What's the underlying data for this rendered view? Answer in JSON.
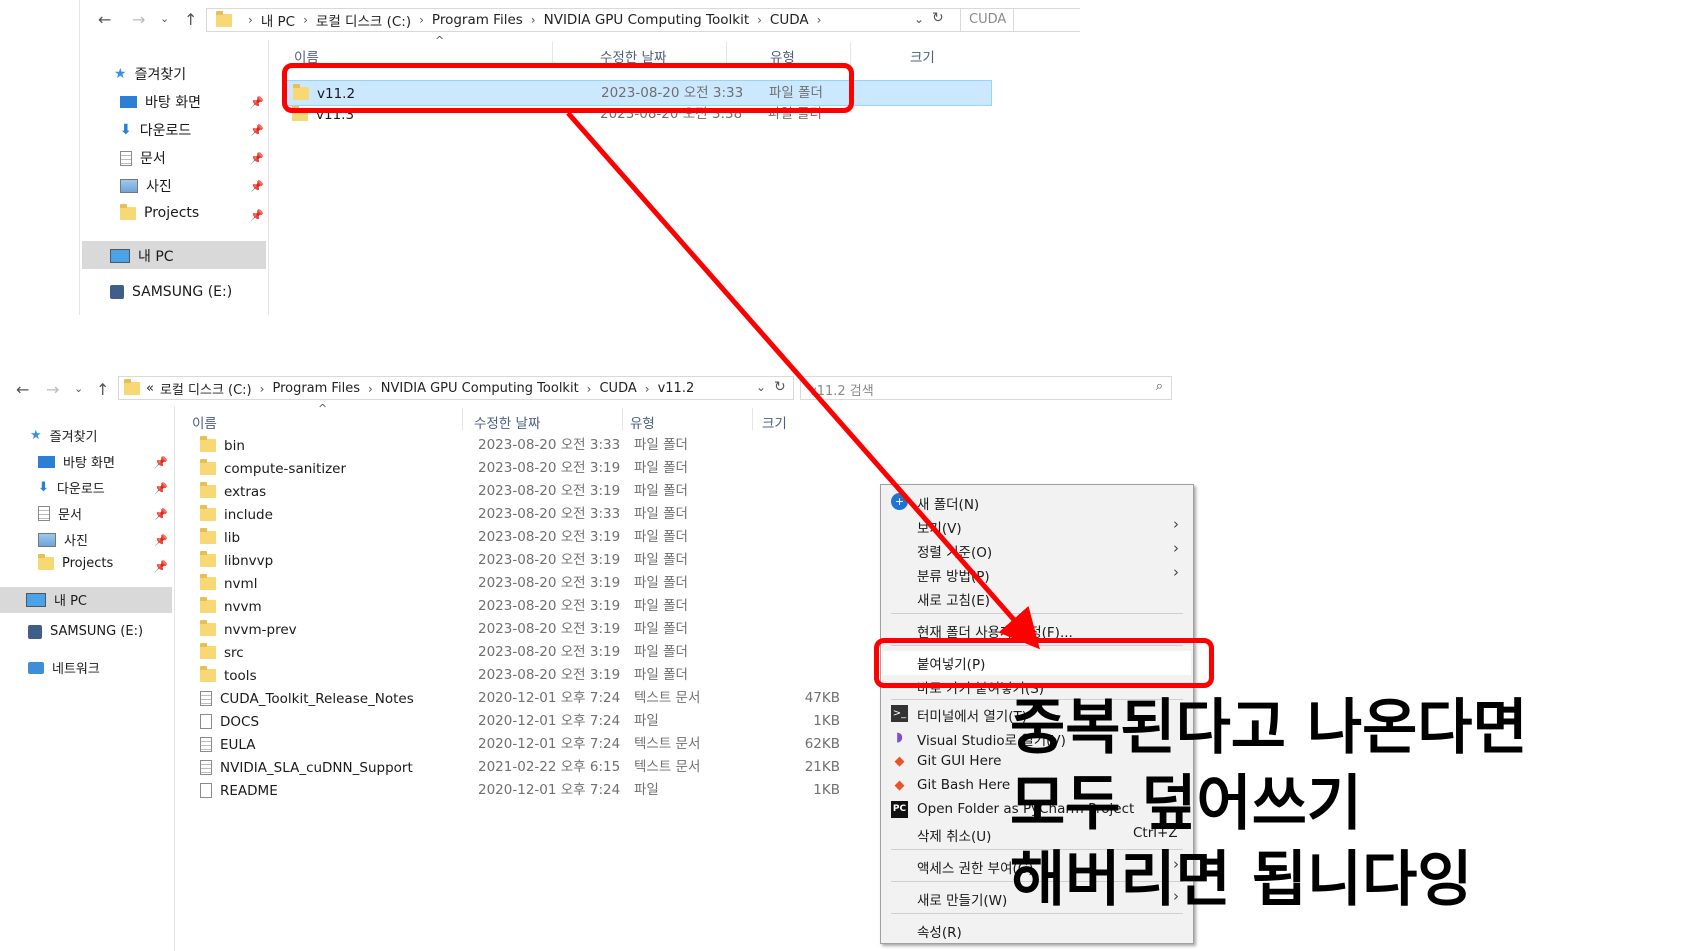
{
  "top_window": {
    "breadcrumb": [
      "내 PC",
      "로컬 디스크 (C:)",
      "Program Files",
      "NVIDIA GPU Computing Toolkit",
      "CUDA"
    ],
    "search_text": "CUDA",
    "columns": [
      "이름",
      "수정한 날짜",
      "유형",
      "크기"
    ],
    "sidebar": {
      "quick_access": "즐겨찾기",
      "items": [
        "바탕 화면",
        "다운로드",
        "문서",
        "사진",
        "Projects"
      ],
      "this_pc": "내 PC",
      "drive": "SAMSUNG (E:)"
    },
    "rows": [
      {
        "name": "v11.2",
        "date": "2023-08-20 오전 3:33",
        "type": "파일 폴더"
      },
      {
        "name": "v11.3",
        "date": "2023-08-20 오전 3:38",
        "type": "파일 폴더"
      }
    ]
  },
  "bottom_window": {
    "breadcrumb_prefix": "«",
    "breadcrumb": [
      "로컬 디스크 (C:)",
      "Program Files",
      "NVIDIA GPU Computing Toolkit",
      "CUDA",
      "v11.2"
    ],
    "search_placeholder": "v11.2 검색",
    "columns": [
      "이름",
      "수정한 날짜",
      "유형",
      "크기"
    ],
    "sidebar": {
      "quick_access": "즐겨찾기",
      "items": [
        "바탕 화면",
        "다운로드",
        "문서",
        "사진",
        "Projects"
      ],
      "this_pc": "내 PC",
      "drive": "SAMSUNG (E:)",
      "network": "네트워크"
    },
    "rows": [
      {
        "name": "bin",
        "date": "2023-08-20 오전 3:33",
        "type": "파일 폴더",
        "size": ""
      },
      {
        "name": "compute-sanitizer",
        "date": "2023-08-20 오전 3:19",
        "type": "파일 폴더",
        "size": ""
      },
      {
        "name": "extras",
        "date": "2023-08-20 오전 3:19",
        "type": "파일 폴더",
        "size": ""
      },
      {
        "name": "include",
        "date": "2023-08-20 오전 3:33",
        "type": "파일 폴더",
        "size": ""
      },
      {
        "name": "lib",
        "date": "2023-08-20 오전 3:19",
        "type": "파일 폴더",
        "size": ""
      },
      {
        "name": "libnvvp",
        "date": "2023-08-20 오전 3:19",
        "type": "파일 폴더",
        "size": ""
      },
      {
        "name": "nvml",
        "date": "2023-08-20 오전 3:19",
        "type": "파일 폴더",
        "size": ""
      },
      {
        "name": "nvvm",
        "date": "2023-08-20 오전 3:19",
        "type": "파일 폴더",
        "size": ""
      },
      {
        "name": "nvvm-prev",
        "date": "2023-08-20 오전 3:19",
        "type": "파일 폴더",
        "size": ""
      },
      {
        "name": "src",
        "date": "2023-08-20 오전 3:19",
        "type": "파일 폴더",
        "size": ""
      },
      {
        "name": "tools",
        "date": "2023-08-20 오전 3:19",
        "type": "파일 폴더",
        "size": ""
      },
      {
        "name": "CUDA_Toolkit_Release_Notes",
        "date": "2020-12-01 오후 7:24",
        "type": "텍스트 문서",
        "size": "47KB"
      },
      {
        "name": "DOCS",
        "date": "2020-12-01 오후 7:24",
        "type": "파일",
        "size": "1KB"
      },
      {
        "name": "EULA",
        "date": "2020-12-01 오후 7:24",
        "type": "텍스트 문서",
        "size": "62KB"
      },
      {
        "name": "NVIDIA_SLA_cuDNN_Support",
        "date": "2021-02-22 오후 6:15",
        "type": "텍스트 문서",
        "size": "21KB"
      },
      {
        "name": "README",
        "date": "2020-12-01 오후 7:24",
        "type": "파일",
        "size": "1KB"
      }
    ]
  },
  "context_menu": {
    "items": [
      {
        "label": "새 폴더(N)",
        "icon": "new-folder-icon"
      },
      {
        "label": "보기(V)",
        "submenu": true
      },
      {
        "label": "정렬 기준(O)",
        "submenu": true
      },
      {
        "label": "분류 방법(P)",
        "submenu": true
      },
      {
        "label": "새로 고침(E)"
      },
      {
        "label": "현재 폴더 사용자 지정(F)..."
      },
      {
        "label": "붙여넣기(P)"
      },
      {
        "label": "바로 가기 붙여넣기(S)"
      },
      {
        "label": "터미널에서 열기(T)",
        "icon": "terminal-icon"
      },
      {
        "label": "Visual Studio로 열기(V)",
        "icon": "visual-studio-icon"
      },
      {
        "label": "Git GUI Here",
        "icon": "git-gui-icon"
      },
      {
        "label": "Git Bash Here",
        "icon": "git-bash-icon"
      },
      {
        "label": "Open Folder as PyCharm Project",
        "icon": "pycharm-icon"
      },
      {
        "label": "삭제 취소(U)",
        "shortcut": "Ctrl+Z"
      },
      {
        "label": "액세스 권한 부여(G)",
        "submenu": true
      },
      {
        "label": "새로 만들기(W)",
        "submenu": true
      },
      {
        "label": "속성(R)"
      }
    ]
  },
  "annotation": {
    "lines": [
      "중복된다고 나온다면",
      "모두 덮어쓰기",
      "해버리면 됩니다잉"
    ],
    "color": "#ff0000"
  }
}
